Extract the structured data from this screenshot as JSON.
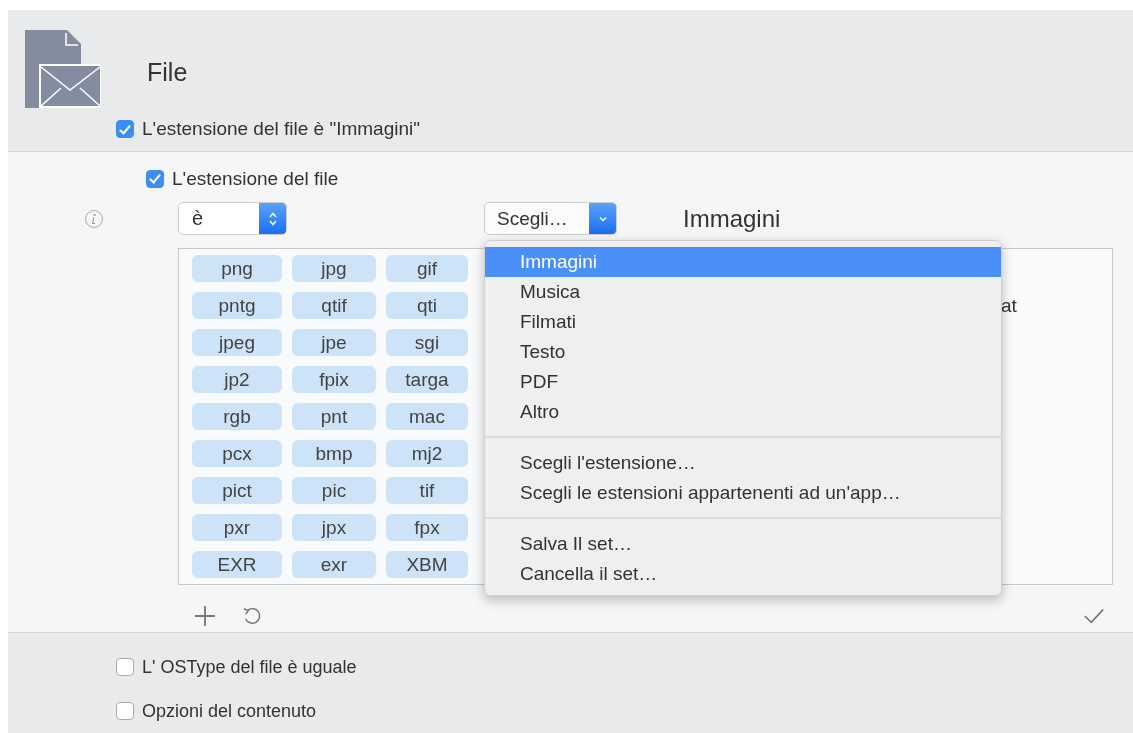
{
  "header": {
    "title": "File",
    "condition": {
      "label": "L'estensione del file è \"Immagini\"",
      "checked": true
    }
  },
  "rule": {
    "checkbox": {
      "label": "L'estensione del file",
      "checked": true
    },
    "operator": "è",
    "set_button": "Scegli…",
    "set_name": "Immagini",
    "tags": [
      [
        "png",
        "jpg",
        "gif"
      ],
      [
        "pntg",
        "qtif",
        "qti"
      ],
      [
        "jpeg",
        "jpe",
        "sgi"
      ],
      [
        "jp2",
        "fpix",
        "targa"
      ],
      [
        "rgb",
        "pnt",
        "mac"
      ],
      [
        "pcx",
        "bmp",
        "mj2"
      ],
      [
        "pict",
        "pic",
        "tif"
      ],
      [
        "pxr",
        "jpx",
        "fpx"
      ],
      [
        "EXR",
        "exr",
        "XBM"
      ]
    ],
    "side_text": "at",
    "menu": {
      "sections": [
        [
          {
            "label": "Immagini",
            "selected": true
          },
          {
            "label": "Musica",
            "selected": false
          },
          {
            "label": "Filmati",
            "selected": false
          },
          {
            "label": "Testo",
            "selected": false
          },
          {
            "label": "PDF",
            "selected": false
          },
          {
            "label": "Altro",
            "selected": false
          }
        ],
        [
          {
            "label": "Scegli l'estensione…",
            "selected": false
          },
          {
            "label": "Scegli le estensioni appartenenti ad un'app…",
            "selected": false
          }
        ],
        [
          {
            "label": "Salva Il set…",
            "selected": false
          },
          {
            "label": "Cancella il set…",
            "selected": false
          }
        ]
      ]
    }
  },
  "conditions": [
    {
      "label": "L' OSType del file è uguale",
      "checked": false
    },
    {
      "label": "Opzioni del contenuto",
      "checked": false
    }
  ]
}
